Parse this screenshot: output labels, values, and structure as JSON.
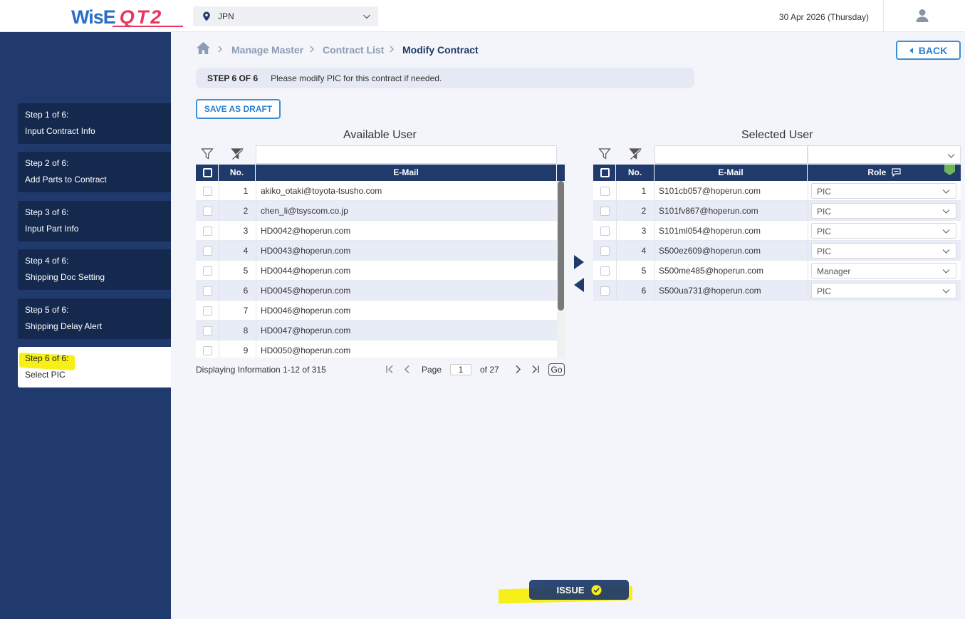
{
  "header": {
    "logo_wise": "WisE",
    "logo_qt": "QT2",
    "region": "JPN",
    "date": "30 Apr 2026 (Thursday)"
  },
  "sidebar": {
    "steps": [
      {
        "step": "Step 1 of 6:",
        "label": "Input Contract Info"
      },
      {
        "step": "Step 2 of 6:",
        "label": "Add Parts to Contract"
      },
      {
        "step": "Step 3 of 6:",
        "label": "Input Part Info"
      },
      {
        "step": "Step 4 of 6:",
        "label": "Shipping Doc Setting"
      },
      {
        "step": "Step 5 of 6:",
        "label": "Shipping Delay Alert"
      },
      {
        "step": "Step 6 of 6:",
        "label": "Select PIC"
      }
    ]
  },
  "breadcrumb": {
    "items": [
      "Manage Master",
      "Contract List",
      "Modify Contract"
    ]
  },
  "back_label": "BACK",
  "stepbar": {
    "step": "STEP 6 OF 6",
    "message": "Please modify PIC for this contract if needed."
  },
  "draft_label": "SAVE AS DRAFT",
  "available": {
    "title": "Available User",
    "headers": {
      "no": "No.",
      "email": "E-Mail"
    },
    "rows": [
      {
        "no": "1",
        "email": "akiko_otaki@toyota-tsusho.com"
      },
      {
        "no": "2",
        "email": "chen_li@tsyscom.co.jp"
      },
      {
        "no": "3",
        "email": "HD0042@hoperun.com"
      },
      {
        "no": "4",
        "email": "HD0043@hoperun.com"
      },
      {
        "no": "5",
        "email": "HD0044@hoperun.com"
      },
      {
        "no": "6",
        "email": "HD0045@hoperun.com"
      },
      {
        "no": "7",
        "email": "HD0046@hoperun.com"
      },
      {
        "no": "8",
        "email": "HD0047@hoperun.com"
      },
      {
        "no": "9",
        "email": "HD0050@hoperun.com"
      }
    ]
  },
  "selected": {
    "title": "Selected User",
    "headers": {
      "no": "No.",
      "email": "E-Mail",
      "role": "Role"
    },
    "rows": [
      {
        "no": "1",
        "email": "S101cb057@hoperun.com",
        "role": "PIC"
      },
      {
        "no": "2",
        "email": "S101fv867@hoperun.com",
        "role": "PIC"
      },
      {
        "no": "3",
        "email": "S101ml054@hoperun.com",
        "role": "PIC"
      },
      {
        "no": "4",
        "email": "S500ez609@hoperun.com",
        "role": "PIC"
      },
      {
        "no": "5",
        "email": "S500me485@hoperun.com",
        "role": "Manager"
      },
      {
        "no": "6",
        "email": "S500ua731@hoperun.com",
        "role": "PIC"
      }
    ]
  },
  "pager": {
    "info": "Displaying Information 1-12 of 315",
    "page_label": "Page",
    "page": "1",
    "of_label": "of 27",
    "go": "Go"
  },
  "issue_label": "ISSUE",
  "colors": {
    "navy": "#1f3a6b",
    "sidebar": "#213a6e",
    "accent": "#3a8fd8",
    "highlight": "#f6ef18",
    "logo_blue": "#2a6ec6",
    "logo_red": "#e8365d"
  }
}
